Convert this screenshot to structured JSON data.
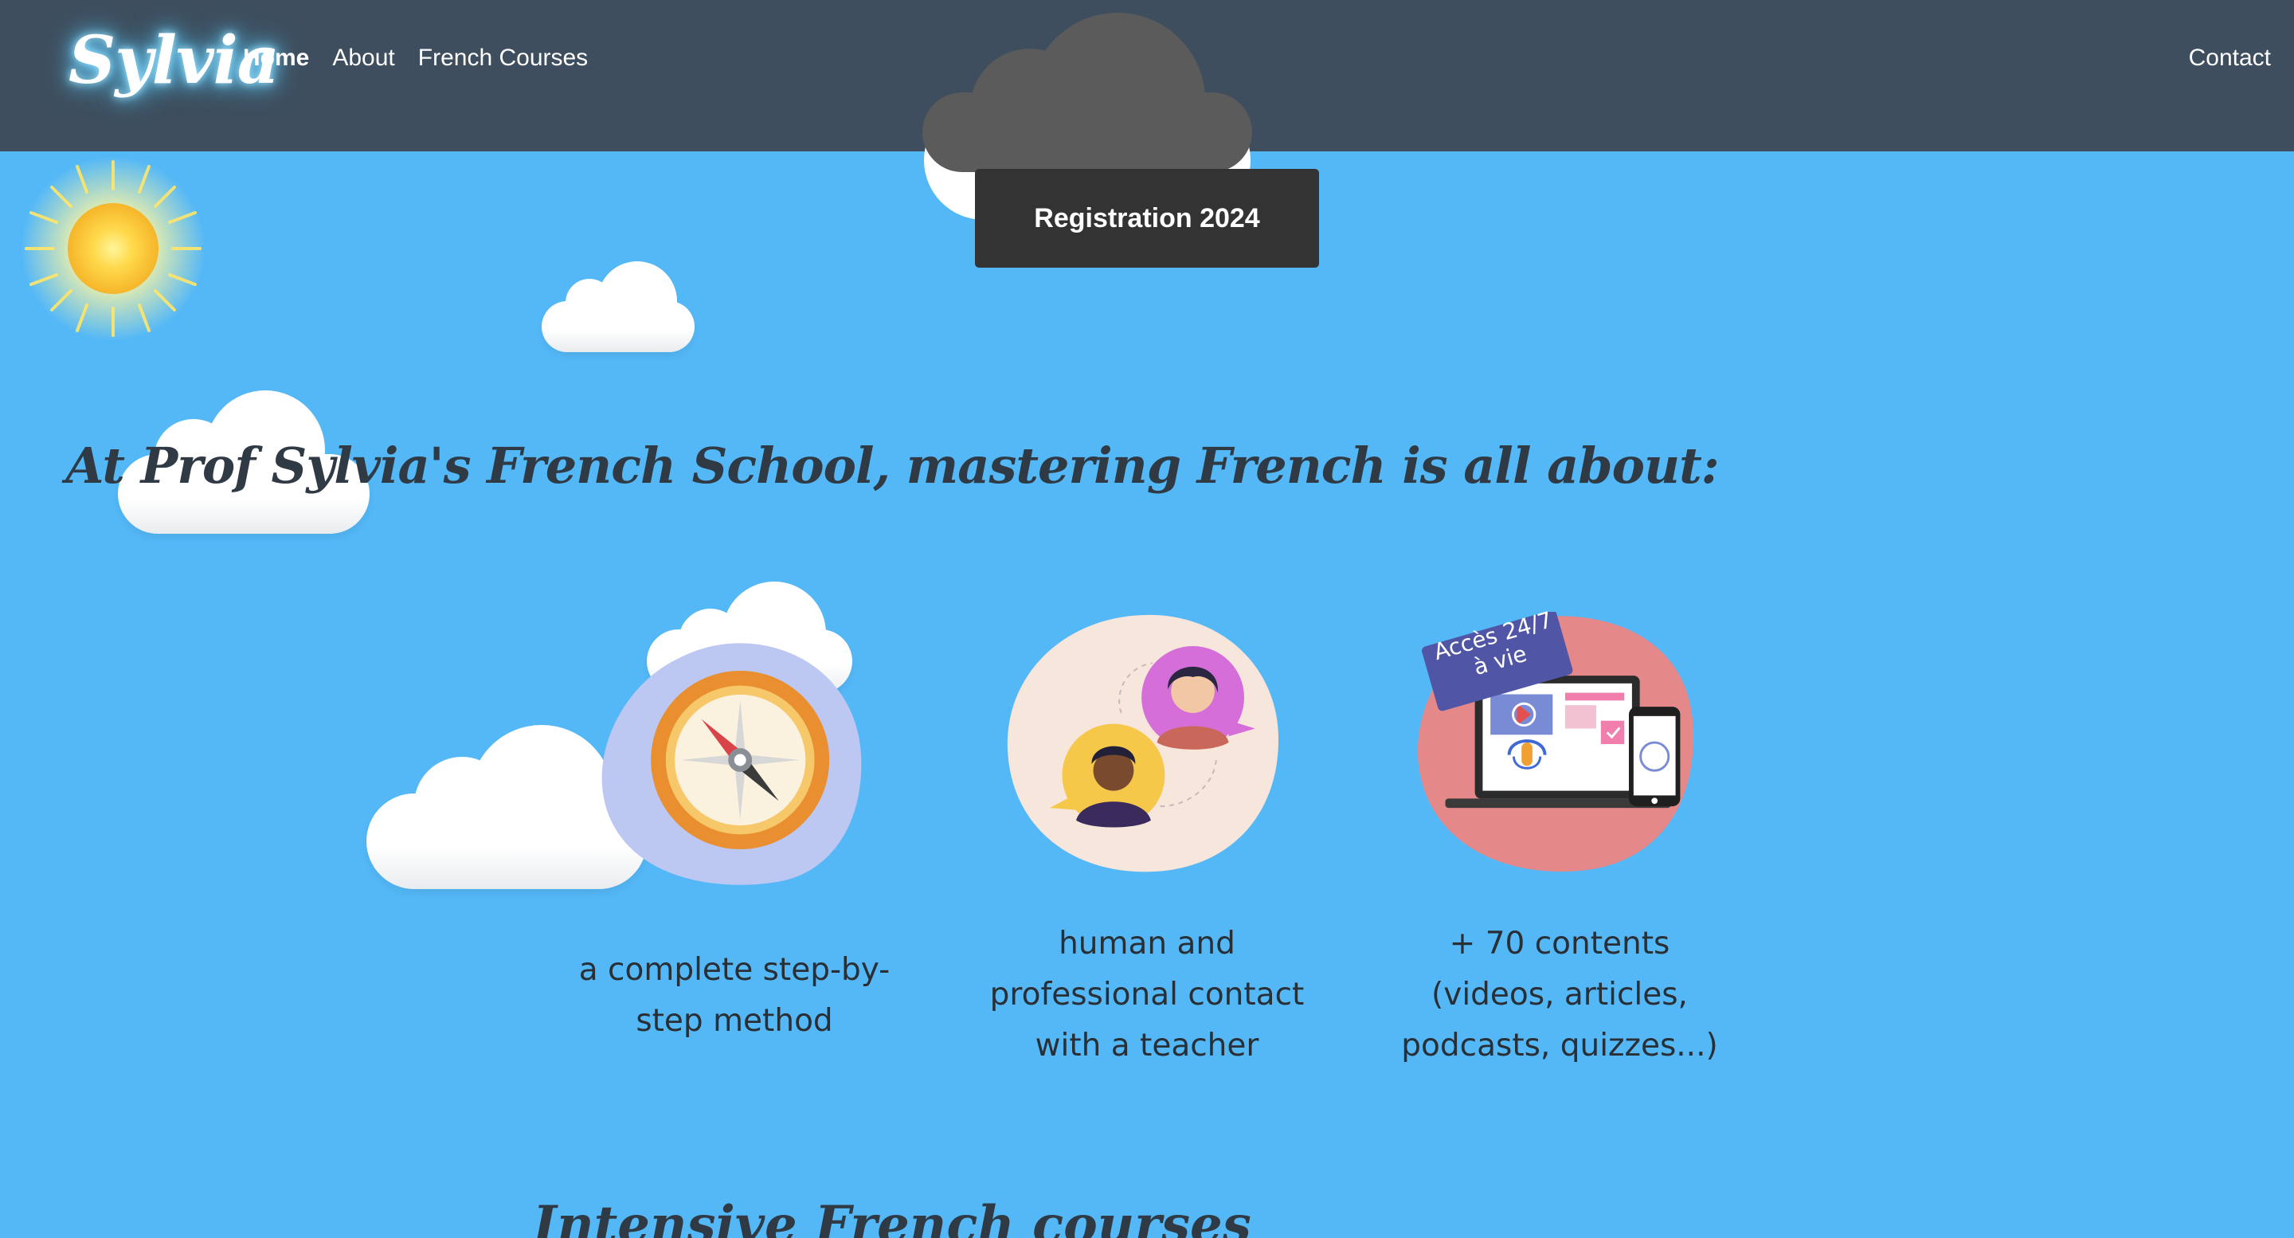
{
  "header": {
    "logo": "Sylvia",
    "nav": [
      {
        "label": "Home",
        "active": true
      },
      {
        "label": "About",
        "active": false
      },
      {
        "label": "French Courses",
        "active": false
      }
    ],
    "contact_label": "Contact"
  },
  "hero": {
    "registration_button": "Registration 2024"
  },
  "main": {
    "heading": "At Prof Sylvia's French School, mastering French is all about:",
    "features": [
      {
        "icon": "compass-icon",
        "caption": "a complete step-by-step method"
      },
      {
        "icon": "conversation-icon",
        "caption": "human and professional contact with a teacher"
      },
      {
        "icon": "devices-icon",
        "badge_line1": "Accès 24/7",
        "badge_line2": "à vie",
        "caption": "+ 70 contents (videos, articles, podcasts, quizzes...)"
      }
    ],
    "section2_heading": "Intensive French courses"
  },
  "colors": {
    "sky": "#54b8f7",
    "header": "#3e4e5e",
    "button": "#333333",
    "heading_text": "#2f3a45"
  }
}
